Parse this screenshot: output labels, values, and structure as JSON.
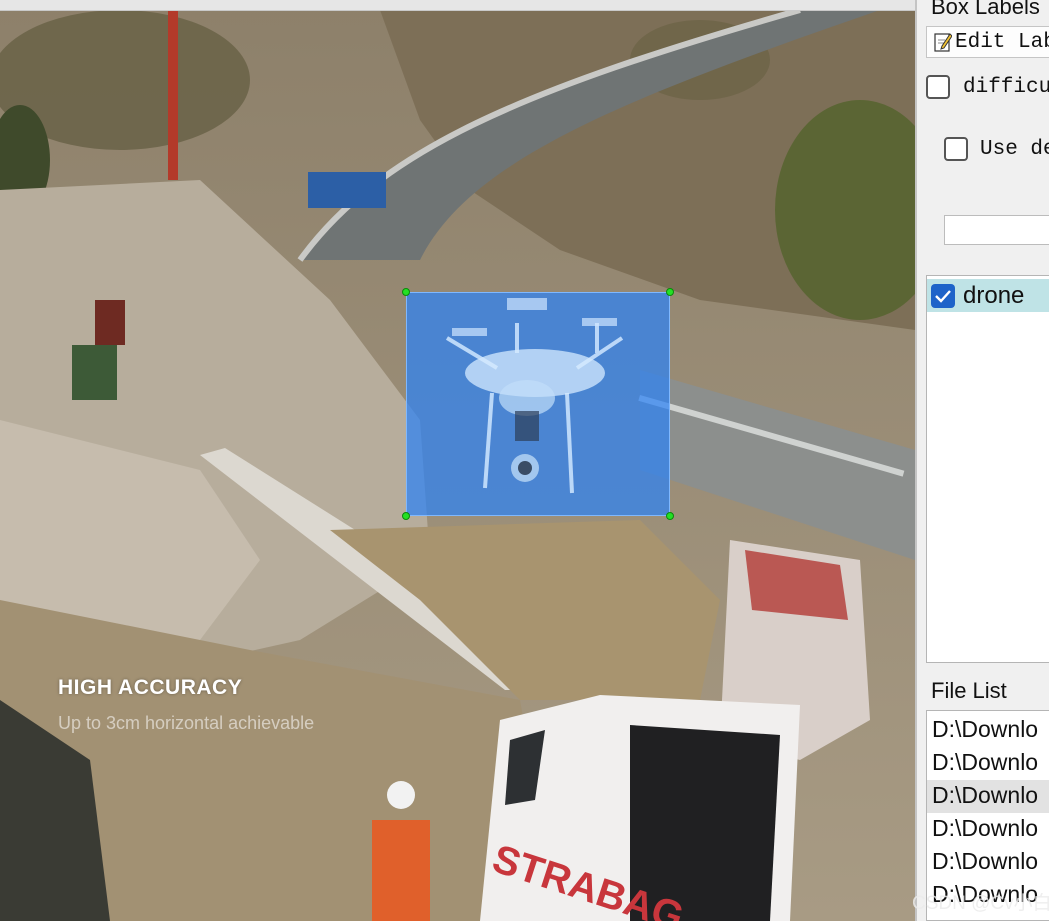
{
  "canvas": {
    "overlay_title": "HIGH ACCURACY",
    "overlay_subtitle": "Up to 3cm horizontal achievable",
    "annotation": {
      "label": "drone",
      "fill_color": "#2d82f5",
      "handle_color": "#24e024"
    }
  },
  "panel": {
    "box_labels_title": "Box Labels",
    "edit_label_button": "Edit Label",
    "difficult_checkbox": {
      "label": "difficult",
      "checked": false
    },
    "use_default_checkbox": {
      "label": "Use default label",
      "checked": false
    },
    "default_label_input": {
      "value": ""
    },
    "labels": [
      {
        "name": "drone",
        "checked": true,
        "selected": true
      }
    ],
    "file_list_title": "File List",
    "files": [
      {
        "path": "D:\\Downlo",
        "selected": false
      },
      {
        "path": "D:\\Downlo",
        "selected": false
      },
      {
        "path": "D:\\Downlo",
        "selected": true
      },
      {
        "path": "D:\\Downlo",
        "selected": false
      },
      {
        "path": "D:\\Downlo",
        "selected": false
      },
      {
        "path": "D:\\Downlo",
        "selected": false
      }
    ]
  },
  "watermark": "CSDN @Cv小白"
}
